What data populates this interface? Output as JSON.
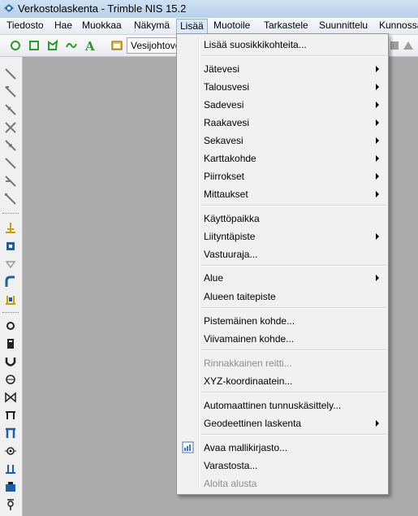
{
  "window": {
    "title": "Verkostolaskenta - Trimble NIS 15.2"
  },
  "menubar": {
    "items": [
      "Tiedosto",
      "Hae",
      "Muokkaa",
      "Näkymä",
      "Lisää",
      "Muotoile",
      "Tarkastele",
      "Suunnittelu",
      "Kunnossapito"
    ],
    "active": "Lisää"
  },
  "toolbar": {
    "layer_combo_value": "Vesijohtoverkko"
  },
  "dropdown": {
    "items": [
      {
        "label": "Lisää suosikkikohteita...",
        "submenu": false,
        "disabled": false
      },
      {
        "label": "Jätevesi",
        "submenu": true,
        "disabled": false
      },
      {
        "label": "Talousvesi",
        "submenu": true,
        "disabled": false
      },
      {
        "label": "Sadevesi",
        "submenu": true,
        "disabled": false
      },
      {
        "label": "Raakavesi",
        "submenu": true,
        "disabled": false
      },
      {
        "label": "Sekavesi",
        "submenu": true,
        "disabled": false
      },
      {
        "label": "Karttakohde",
        "submenu": true,
        "disabled": false
      },
      {
        "label": "Piirrokset",
        "submenu": true,
        "disabled": false
      },
      {
        "label": "Mittaukset",
        "submenu": true,
        "disabled": false
      },
      {
        "label": "Käyttöpaikka",
        "submenu": false,
        "disabled": false
      },
      {
        "label": "Liityntäpiste",
        "submenu": true,
        "disabled": false
      },
      {
        "label": "Vastuuraja...",
        "submenu": false,
        "disabled": false
      },
      {
        "label": "Alue",
        "submenu": true,
        "disabled": false
      },
      {
        "label": "Alueen taitepiste",
        "submenu": false,
        "disabled": false
      },
      {
        "label": "Pistemäinen kohde...",
        "submenu": false,
        "disabled": false
      },
      {
        "label": "Viivamainen kohde...",
        "submenu": false,
        "disabled": false
      },
      {
        "label": "Rinnakkainen reitti...",
        "submenu": false,
        "disabled": true
      },
      {
        "label": "XYZ-koordinaatein...",
        "submenu": false,
        "disabled": false
      },
      {
        "label": "Automaattinen tunnuskäsittely...",
        "submenu": false,
        "disabled": false
      },
      {
        "label": "Geodeettinen laskenta",
        "submenu": true,
        "disabled": false
      },
      {
        "label": "Avaa mallikirjasto...",
        "submenu": false,
        "disabled": false,
        "icon": "library-icon"
      },
      {
        "label": "Varastosta...",
        "submenu": false,
        "disabled": false
      },
      {
        "label": "Aloita alusta",
        "submenu": false,
        "disabled": true
      }
    ]
  },
  "colors": {
    "accent": "#3399ff",
    "menu_bg": "#f1f1f1",
    "workspace": "#ababab",
    "disabled_text": "#8d8d8d"
  }
}
